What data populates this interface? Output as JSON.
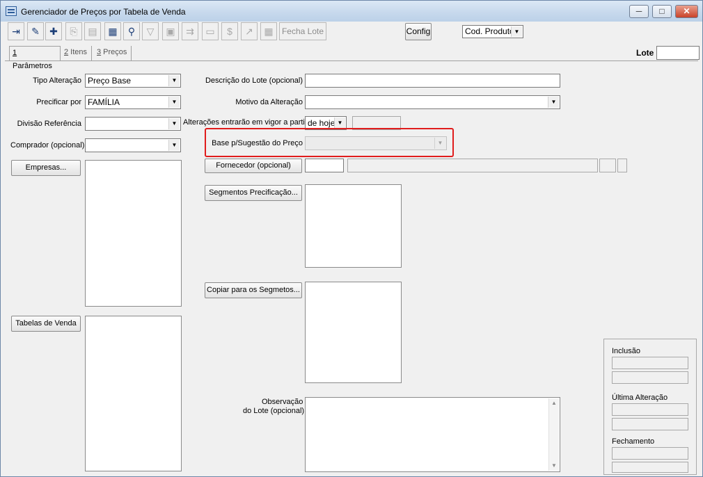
{
  "window": {
    "title": "Gerenciador de Preços por Tabela de Venda",
    "controls": [
      "─",
      "□",
      "✕"
    ]
  },
  "toolbar": {
    "fecha_lote": "Fecha Lote",
    "config": "Config",
    "sort_select": "Cod. Produto"
  },
  "tabs": [
    {
      "key": "1",
      "label": " Parâmetros"
    },
    {
      "key": "2",
      "label": " Itens"
    },
    {
      "key": "3",
      "label": " Preços"
    }
  ],
  "lote": {
    "label": "Lote",
    "value": ""
  },
  "form": {
    "tipo_alteracao": {
      "label": "Tipo Alteração",
      "value": "Preço Base"
    },
    "precificar_por": {
      "label": "Precificar por",
      "value": "FAMÍLIA"
    },
    "divisao_referencia": {
      "label": "Divisão Referência",
      "value": ""
    },
    "comprador": {
      "label": "Comprador (opcional)",
      "value": ""
    },
    "empresas_button": "Empresas...",
    "tabelas_button": "Tabelas de Venda",
    "descricao_lote": {
      "label": "Descrição do Lote (opcional)",
      "value": ""
    },
    "motivo_alteracao": {
      "label": "Motivo da Alteração",
      "value": ""
    },
    "vigor": {
      "label": "Alterações entrarão em vigor a partir",
      "value": "de hoje"
    },
    "base_sugestao": {
      "label": "Base p/Sugestão do Preço",
      "value": ""
    },
    "fornecedor_button": "Fornecedor (opcional)",
    "segmentos_button": "Segmentos Precificação...",
    "copiar_button": "Copiar para os Segmetos...",
    "observacao_label_1": "Observação",
    "observacao_label_2": "do Lote (opcional)"
  },
  "status": {
    "inclusao": "Inclusão",
    "ultima_alteracao": "Última Alteração",
    "fechamento": "Fechamento"
  },
  "colors": {
    "highlight": "#e01c1c"
  }
}
